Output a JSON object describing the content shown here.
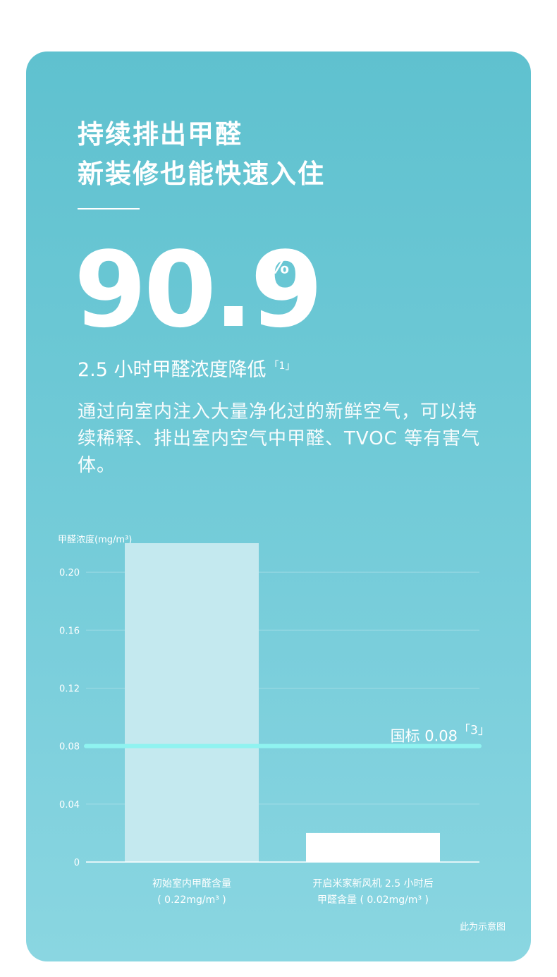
{
  "header": {
    "title_line1": "持续排出甲醛",
    "title_line2": "新装修也能快速入住"
  },
  "highlight": {
    "value": "90.9",
    "unit": "%",
    "caption": "2.5 小时甲醛浓度降低",
    "caption_ref": "「1」"
  },
  "description": "通过向室内注入大量净化过的新鲜空气，可以持续稀释、排出室内空气中甲醛、TVOC 等有害气体。",
  "chart_data": {
    "type": "bar",
    "ylabel": "甲醛浓度(mg/m³)",
    "ylim": [
      0,
      0.22
    ],
    "yticks": [
      0,
      0.04,
      0.08,
      0.12,
      0.16,
      0.2
    ],
    "ytick_labels": [
      "0",
      "0.04",
      "0.08",
      "0.12",
      "0.16",
      "0.20"
    ],
    "grid": true,
    "categories": [
      [
        "初始室内甲醛含量",
        "( 0.22mg/m³ )"
      ],
      [
        "开启米家新风机 2.5 小时后",
        "甲醛含量 ( 0.02mg/m³ )"
      ]
    ],
    "values": [
      0.22,
      0.02
    ],
    "bar_colors": [
      "#c4e9ef",
      "#ffffff"
    ],
    "reference_line": {
      "value": 0.08,
      "label": "国标 0.08",
      "label_ref": "「3」",
      "color": "#8ff3f0"
    }
  },
  "footnote": "此为示意图",
  "colors": {
    "card_top": "#5fc1cf",
    "card_bottom": "#8ad6e1",
    "text": "#ffffff"
  }
}
